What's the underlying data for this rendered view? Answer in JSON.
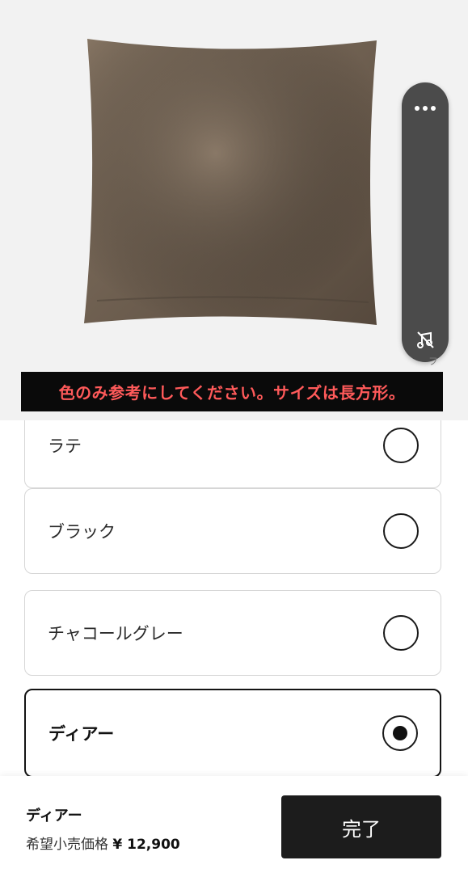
{
  "product": {
    "image_alt": "velvet cushion",
    "caption": "色のみ参考にしてください。サイズは長方形。",
    "caption_color": "#ff5a5a"
  },
  "floating_toolbar": {
    "more_icon": "more-horizontal-icon",
    "mute_icon": "audio-off-icon",
    "tail_text": "フ"
  },
  "color_options": [
    {
      "label": "ラテ",
      "selected": false
    },
    {
      "label": "ブラック",
      "selected": false
    },
    {
      "label": "チャコールグレー",
      "selected": false
    },
    {
      "label": "ディアー",
      "selected": true
    }
  ],
  "footer": {
    "selected_name": "ディアー",
    "price_label": "希望小売価格",
    "price_value": "¥ 12,900",
    "done_label": "完了",
    "button_color": "#1c1c1c"
  }
}
